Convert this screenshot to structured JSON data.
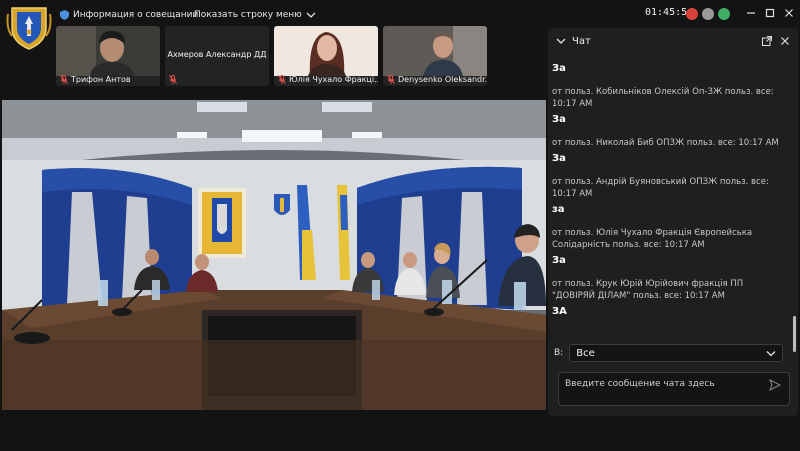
{
  "topbar": {
    "meeting_info_label": "Информация о совещании",
    "show_menu_label": "Показать строку меню",
    "time": "01:45:54"
  },
  "participants": [
    {
      "name": "Трифон Антов",
      "muted": true,
      "has_video": true
    },
    {
      "name": "Ахмеров Александр ДД",
      "muted": true,
      "has_video": false
    },
    {
      "name": "Юлія Чухало Фракці...",
      "muted": true,
      "has_video": true
    },
    {
      "name": "Denysenko Oleksandr...",
      "muted": true,
      "has_video": true
    }
  ],
  "chat": {
    "title": "Чат",
    "first_body": "За",
    "messages": [
      {
        "meta": "от польз. Кобильніков Олексій Оп-ЗЖ польз. все: 10:17 AM",
        "body": "За"
      },
      {
        "meta": "от польз. Николай Биб ОПЗЖ польз. все: 10:17 AM",
        "body": "За"
      },
      {
        "meta": "от польз. Андрій Буяновський ОПЗЖ польз. все: 10:17 AM",
        "body": "за"
      },
      {
        "meta": "от польз. Юлія Чухало Фракція Європейська Солідарність польз. все: 10:17 AM",
        "body": "За"
      },
      {
        "meta": "от польз. Крук Юрій Юрійович фракція ПП \"ДОВІРЯЙ ДІЛАМ\" польз. все: 10:17 AM",
        "body": "ЗА"
      }
    ],
    "to_label": "В:",
    "to_value": "Все",
    "input_placeholder": "Введите сообщение чата здесь"
  },
  "colors": {
    "background": "#131313",
    "panel": "#1f1f1f",
    "accent_red": "#d9423b",
    "accent_green": "#3fae62",
    "muted_mic": "#e0524b"
  }
}
